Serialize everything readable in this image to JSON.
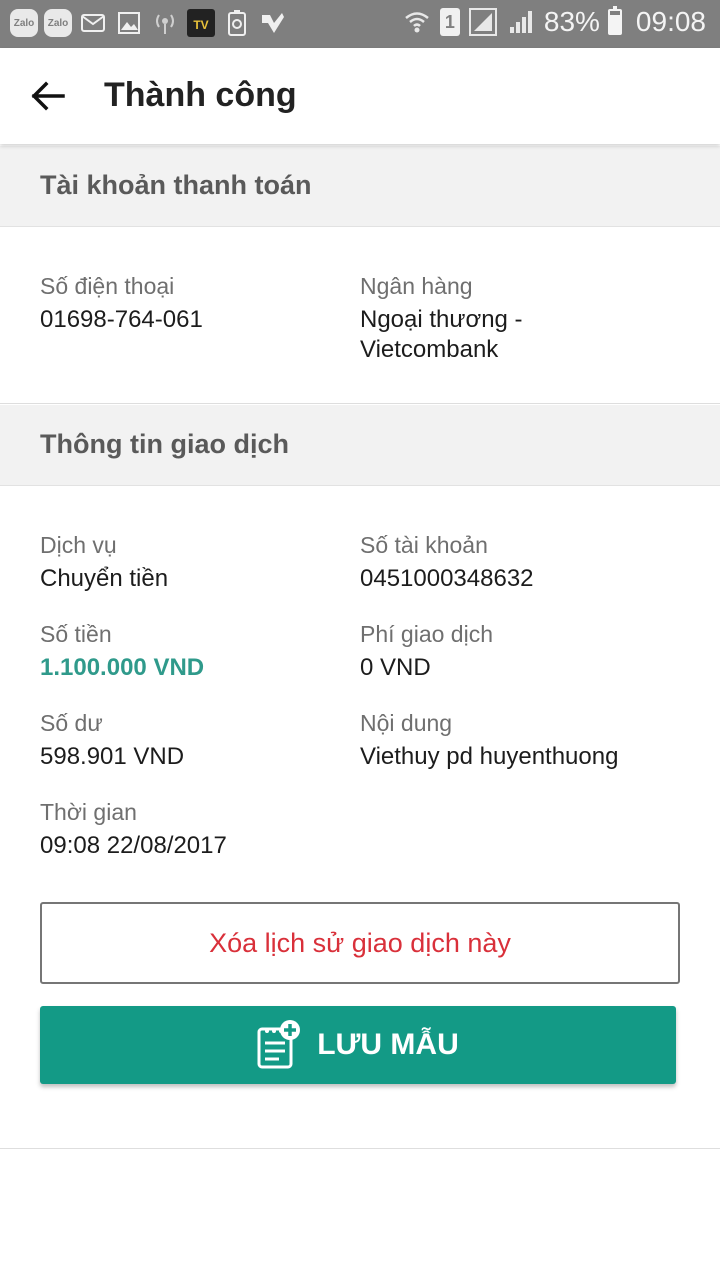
{
  "status_bar": {
    "app_icons": [
      "Zalo",
      "Zalo"
    ],
    "battery": "83%",
    "battery_level": 0.83,
    "time": "09:08",
    "sim_slot": "1"
  },
  "appbar": {
    "title": "Thành công"
  },
  "payment_account": {
    "heading": "Tài khoản thanh toán",
    "phone_label": "Số điện thoại",
    "phone_value": "01698-764-061",
    "bank_label": "Ngân hàng",
    "bank_value_line1": "Ngoại thương -",
    "bank_value_line2": "Vietcombank"
  },
  "transaction": {
    "heading": "Thông tin giao dịch",
    "service_label": "Dịch vụ",
    "service_value": "Chuyển tiền",
    "account_label": "Số tài khoản",
    "account_value": "0451000348632",
    "amount_label": "Số tiền",
    "amount_value": "1.100.000 VND",
    "fee_label": "Phí giao dịch",
    "fee_value": "0 VND",
    "balance_label": "Số dư",
    "balance_value": "598.901 VND",
    "content_label": "Nội dung",
    "content_value": "Viethuy pd huyenthuong",
    "time_label": "Thời gian",
    "time_value": "09:08 22/08/2017"
  },
  "actions": {
    "delete_label": "Xóa lịch sử giao dịch này",
    "save_label": "LƯU MẪU"
  },
  "colors": {
    "accent": "#139a86",
    "amount": "#2f9a8b",
    "danger": "#d9303a",
    "statusbar": "#7f7f7f"
  }
}
